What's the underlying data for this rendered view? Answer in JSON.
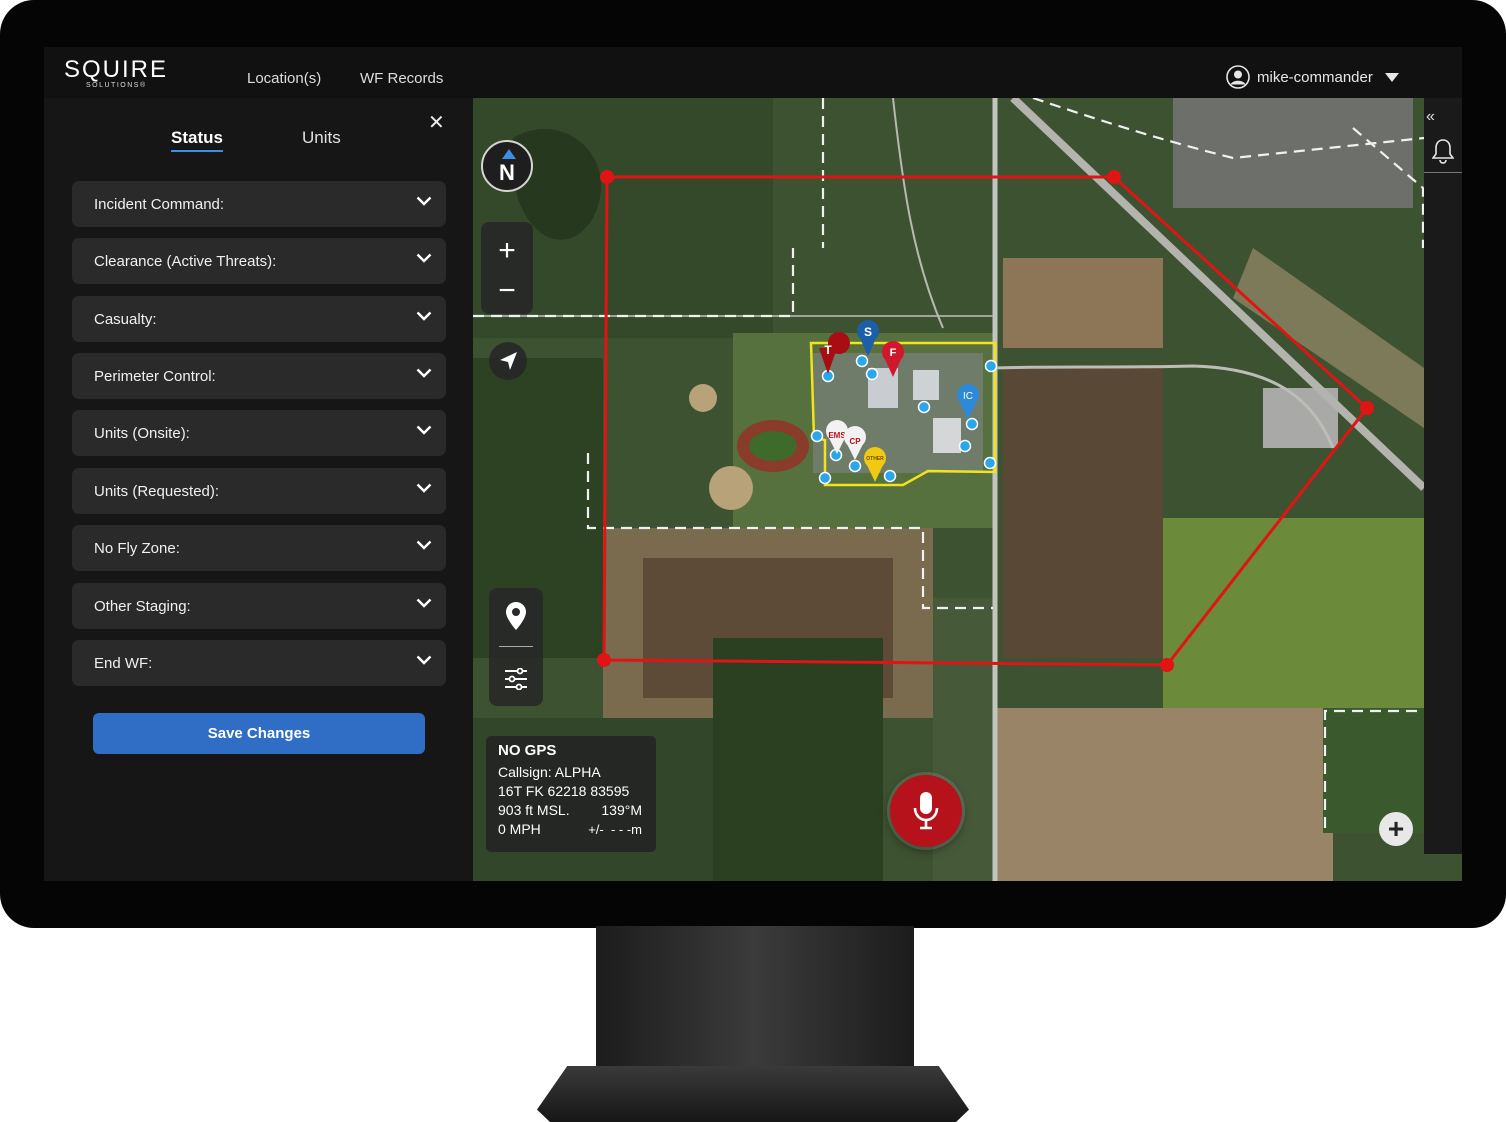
{
  "brand": {
    "logo_text": "SQUIRE",
    "logo_sub": "SOLUTIONS®"
  },
  "nav": {
    "links": [
      "Location(s)",
      "WF Records"
    ]
  },
  "user": {
    "name": "mike-commander"
  },
  "panel": {
    "tabs": [
      {
        "label": "Status",
        "active": true
      },
      {
        "label": "Units",
        "active": false
      }
    ],
    "sections": [
      "Incident Command:",
      "Clearance (Active Threats):",
      "Casualty:",
      "Perimeter Control:",
      "Units (Onsite):",
      "Units (Requested):",
      "No Fly Zone:",
      "Other Staging:",
      "End WF:"
    ],
    "save_label": "Save Changes"
  },
  "map": {
    "compass_label": "N",
    "zoom_in": "+",
    "zoom_out": "−",
    "markers": {
      "ic": "IC",
      "ems": "EMS",
      "cp": "CP",
      "other": "OTHER",
      "s": "S"
    },
    "gps": {
      "status": "NO GPS",
      "callsign": "Callsign: ALPHA",
      "grid": "16T FK 62218 83595",
      "altitude": "903 ft MSL.",
      "heading": "139°M",
      "speed": "0 MPH",
      "accuracy": "+/-  - - -m"
    },
    "add_label": "+"
  },
  "colors": {
    "accent": "#3a8ee6",
    "danger": "#e01414",
    "mic": "#b5121b",
    "zone": "#f2e31c",
    "save": "#2f6ec4"
  },
  "icons": [
    "user-icon",
    "caret-down-icon",
    "close-icon",
    "chevron-down-icon",
    "compass-icon",
    "zoom-in-icon",
    "zoom-out-icon",
    "navigation-arrow-icon",
    "map-pin-icon",
    "sliders-icon",
    "microphone-icon",
    "bell-icon",
    "double-chevron-left-icon",
    "plus-icon"
  ]
}
